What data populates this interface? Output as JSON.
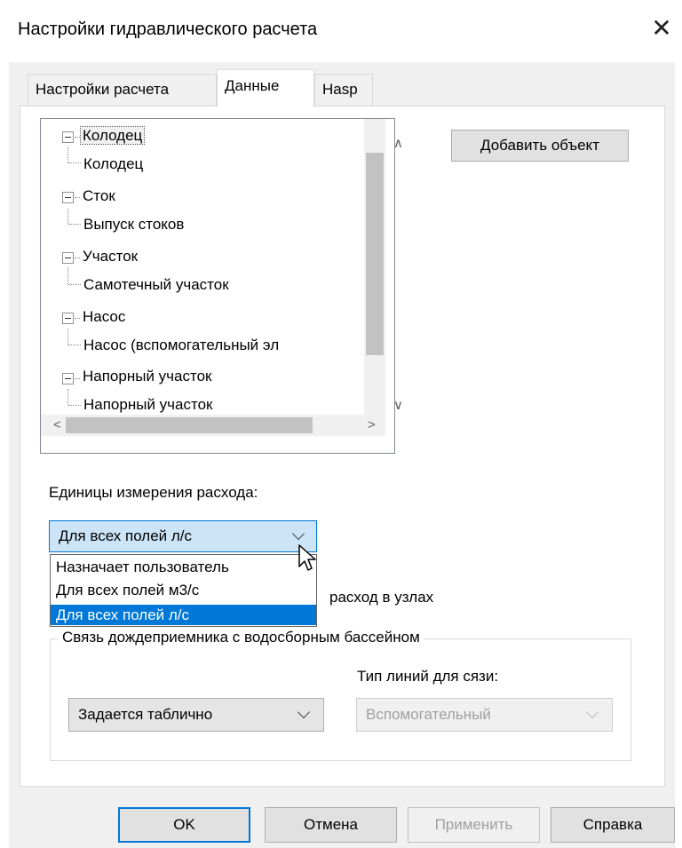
{
  "window": {
    "title": "Настройки гидравлического расчета",
    "close_glyph": "✕"
  },
  "tabs": [
    {
      "label": "Настройки расчета",
      "active": false
    },
    {
      "label": "Данные",
      "active": true
    },
    {
      "label": "Hasp",
      "active": false
    }
  ],
  "tree": {
    "nodes": [
      {
        "label": "Колодец",
        "level": 0,
        "expanded": true,
        "focused": true
      },
      {
        "label": "Колодец",
        "level": 1
      },
      {
        "label": "Сток",
        "level": 0,
        "expanded": true
      },
      {
        "label": "Выпуск стоков",
        "level": 1
      },
      {
        "label": "Участок",
        "level": 0,
        "expanded": true
      },
      {
        "label": "Самотечный участок",
        "level": 1
      },
      {
        "label": "Насос",
        "level": 0,
        "expanded": true
      },
      {
        "label": "Насос (вспомогательный эл",
        "level": 1
      },
      {
        "label": "Напорный участок",
        "level": 0,
        "expanded": true
      },
      {
        "label": "Напорный участок",
        "level": 1
      }
    ],
    "scroll_up_glyph": "∧",
    "scroll_down_glyph": "∨",
    "scroll_left_glyph": "<",
    "scroll_right_glyph": ">"
  },
  "add_object_button": "Добавить объект",
  "flow_units": {
    "label": "Единицы измерения расхода:",
    "selected": "Для всех полей л/с",
    "options": [
      {
        "label": "Назначает пользователь",
        "highlighted": false
      },
      {
        "label": "Для всех полей м3/с",
        "highlighted": false
      },
      {
        "label": "Для всех полей л/с",
        "highlighted": true
      }
    ]
  },
  "partial_text": "расход в узлах",
  "rain_group": {
    "legend": "Связь дождеприемника с водосборным бассейном",
    "line_type_label": "Тип линий для сязи:",
    "mode_select": "Задается таблично",
    "line_type_select": "Вспомогательный"
  },
  "footer": {
    "ok": "OK",
    "cancel": "Отмена",
    "apply": "Применить",
    "help": "Справка"
  },
  "colors": {
    "accent": "#0078d7",
    "dialog_bg": "#f0f0f0",
    "panel_bg": "#ffffff",
    "disabled_text": "#a0a0a0"
  }
}
